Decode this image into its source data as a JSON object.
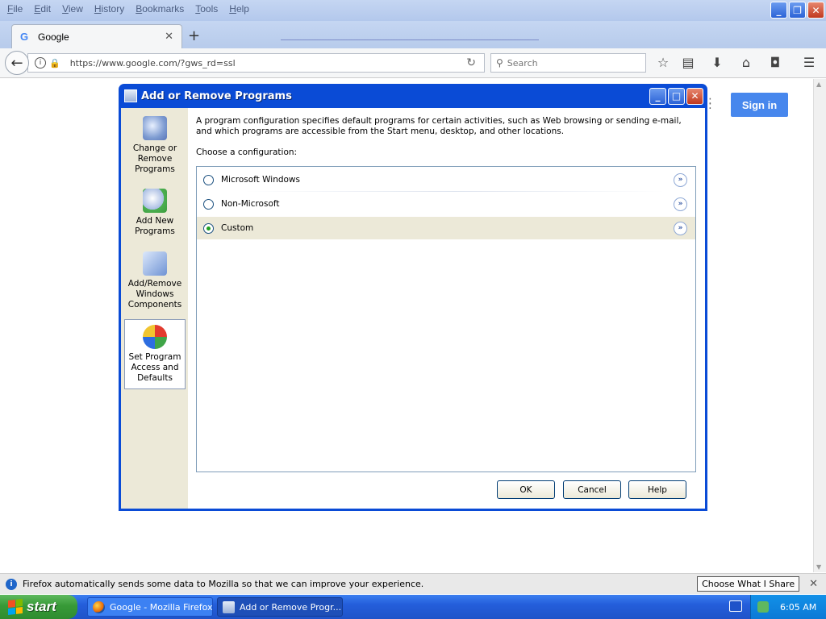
{
  "firefox": {
    "menu": [
      "File",
      "Edit",
      "View",
      "History",
      "Bookmarks",
      "Tools",
      "Help"
    ],
    "tab": {
      "label": "Google",
      "icon": "google-g-icon"
    },
    "url": "https://www.google.com/?gws_rd=ssl",
    "search_placeholder": "Search",
    "toolbar_icons": [
      "star-icon",
      "reading-list-icon",
      "download-icon",
      "home-icon",
      "pocket-icon",
      "hamburger-menu-icon"
    ]
  },
  "page": {
    "signin_label": "Sign in"
  },
  "dialog": {
    "title": "Add or Remove Programs",
    "sidebar": [
      {
        "label": "Change or Remove Programs",
        "icon": "cd-box-icon",
        "active": false
      },
      {
        "label": "Add New Programs",
        "icon": "cd-plus-icon",
        "active": false
      },
      {
        "label": "Add/Remove Windows Components",
        "icon": "windows-components-icon",
        "active": false
      },
      {
        "label": "Set Program Access and Defaults",
        "icon": "program-defaults-icon",
        "active": true
      }
    ],
    "description": "A program configuration specifies default programs for certain activities, such as Web browsing or sending e-mail, and which programs are accessible from the Start menu, desktop, and other locations.",
    "choose_label": "Choose a configuration:",
    "configurations": [
      {
        "label": "Microsoft Windows",
        "checked": false
      },
      {
        "label": "Non-Microsoft",
        "checked": false
      },
      {
        "label": "Custom",
        "checked": true
      }
    ],
    "buttons": {
      "ok": "OK",
      "cancel": "Cancel",
      "help": "Help"
    }
  },
  "notification": {
    "text": "Firefox automatically sends some data to Mozilla so that we can improve your experience.",
    "button": "Choose What I Share"
  },
  "taskbar": {
    "start_label": "start",
    "tasks": [
      "Google - Mozilla Firefox",
      "Add or Remove Progr..."
    ],
    "clock": "6:05 AM"
  },
  "colors": {
    "xp_title_blue": "#0a4bd6",
    "signin_blue": "#4787ed",
    "taskbar_blue": "#245edb",
    "start_green": "#379a37"
  }
}
